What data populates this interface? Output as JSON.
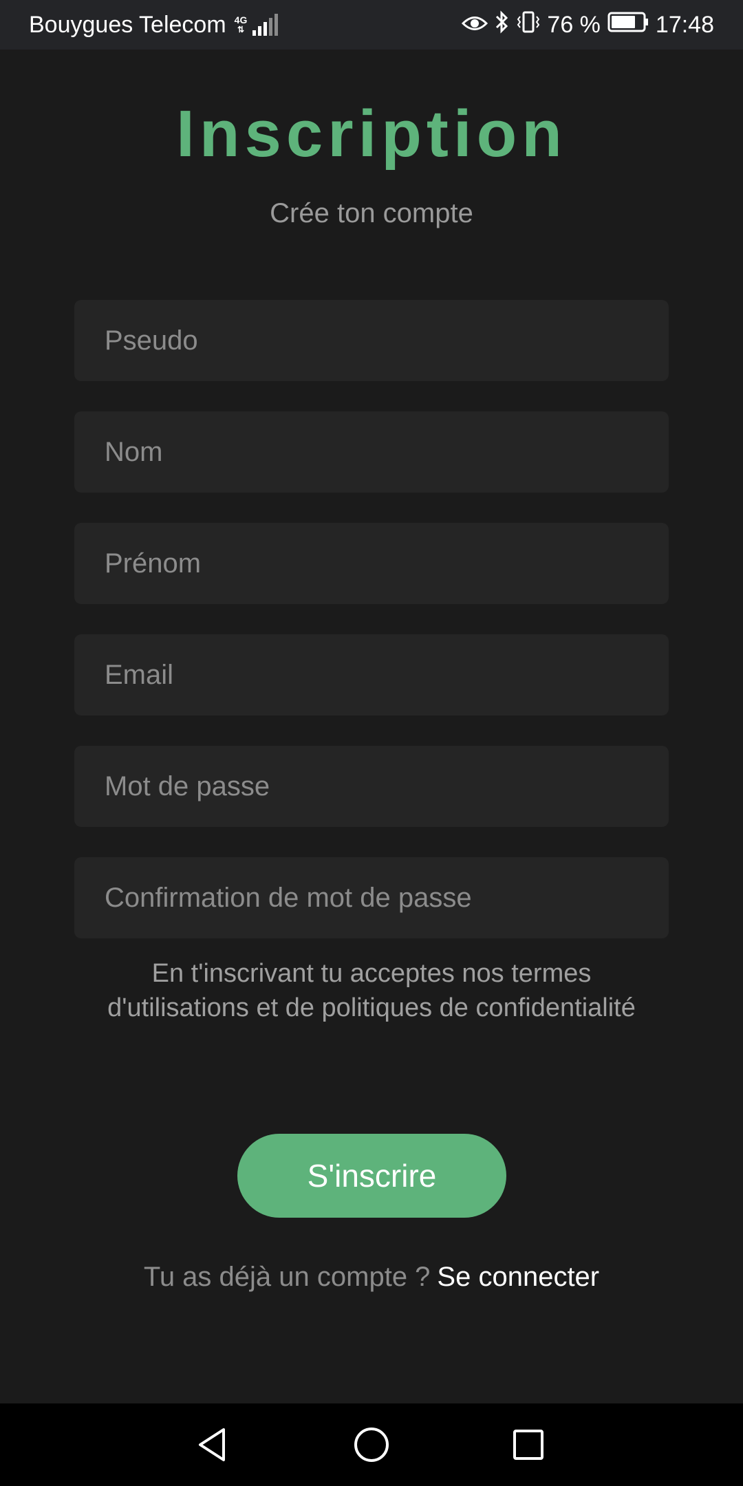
{
  "status_bar": {
    "carrier": "Bouygues Telecom",
    "network": "4G",
    "battery": "76 %",
    "time": "17:48",
    "icons": [
      "eye-icon",
      "bluetooth-icon",
      "vibrate-icon",
      "battery-icon"
    ]
  },
  "header": {
    "title": "Inscription",
    "subtitle": "Crée ton compte"
  },
  "form": {
    "pseudo_placeholder": "Pseudo",
    "nom_placeholder": "Nom",
    "prenom_placeholder": "Prénom",
    "email_placeholder": "Email",
    "password_placeholder": "Mot de passe",
    "confirm_placeholder": "Confirmation de mot de passe",
    "terms": "En t'inscrivant tu acceptes nos termes d'utilisations et de politiques de confidentialité",
    "submit_label": "S'inscrire"
  },
  "footer": {
    "question": "Tu as déjà un compte ?",
    "login_link": "Se connecter"
  },
  "nav_bar": {
    "icons": [
      "back-icon",
      "home-icon",
      "recents-icon"
    ]
  },
  "colors": {
    "accent": "#5eb37b",
    "background": "#1b1b1b",
    "field_background": "#252525",
    "status_bar": "#242528",
    "nav_bar": "#000000"
  }
}
